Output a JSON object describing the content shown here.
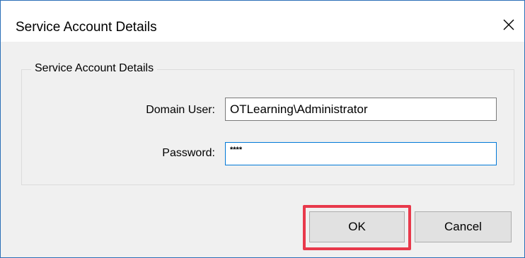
{
  "dialog": {
    "title": "Service Account Details",
    "close_icon": "close-icon"
  },
  "group": {
    "legend": "Service Account Details"
  },
  "fields": {
    "domain_user_label": "Domain User:",
    "domain_user_value": "OTLearning\\Administrator",
    "password_label": "Password:",
    "password_value": "****"
  },
  "buttons": {
    "ok_label": "OK",
    "cancel_label": "Cancel"
  },
  "colors": {
    "highlight": "#e8394b",
    "focus_border": "#0078d7",
    "window_border": "#2b6fb7"
  }
}
